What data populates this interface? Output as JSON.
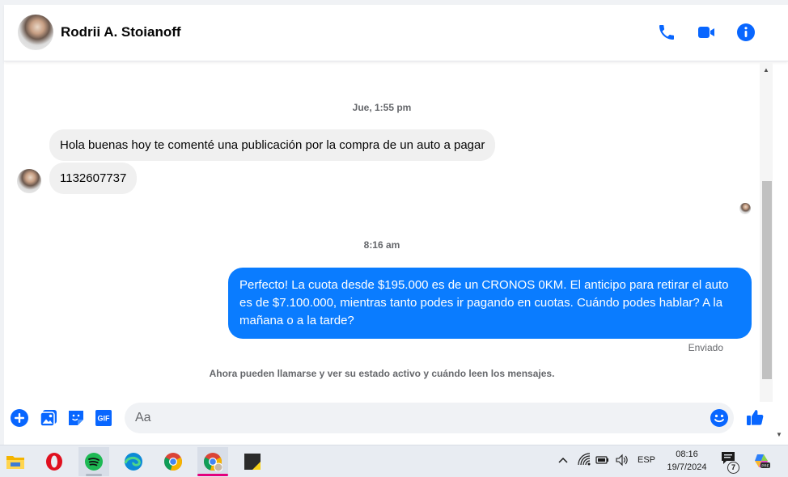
{
  "header": {
    "contact_name": "Rodrii A. Stoianoff",
    "icons": [
      "phone-icon",
      "video-camera-icon",
      "info-icon"
    ]
  },
  "conversation": {
    "timestamp_1": "Jue, 1:55 pm",
    "incoming_1": "Hola buenas hoy te comenté una publicación por la compra de un auto a pagar",
    "incoming_2": "1132607737",
    "timestamp_2": "8:16 am",
    "outgoing_1": "Perfecto! La cuota desde $195.000 es de un CRONOS 0KM. El anticipo para retirar el auto es de $7.100.000, mientras tanto podes ir pagando en cuotas. Cuándo podes hablar? A la mañana o a la tarde?",
    "status": "Enviado",
    "info": "Ahora pueden llamarse y ver su estado activo y cuándo leen los mensajes."
  },
  "composer": {
    "placeholder": "Aa",
    "gif_label": "GIF",
    "icons": [
      "plus-icon",
      "image-icon",
      "sticker-icon",
      "gif-icon",
      "emoji-icon",
      "thumbs-up-icon"
    ]
  },
  "colors": {
    "accent": "#0a7cff",
    "icon_blue": "#0866ff",
    "incoming_bubble": "#f0f0f0",
    "text_secondary": "#65676b"
  },
  "taskbar": {
    "apps": [
      "file-explorer",
      "opera",
      "spotify",
      "edge",
      "chrome",
      "chrome-profile",
      "sticky-notes"
    ],
    "language": "ESP",
    "time": "08:16",
    "date": "19/7/2024",
    "notification_count": "7"
  }
}
